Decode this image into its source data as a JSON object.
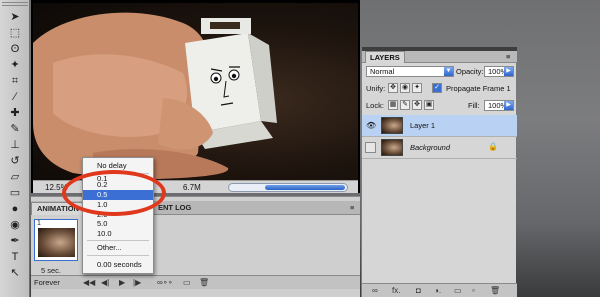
{
  "toolbox": {
    "tools": [
      {
        "icon": "move-tool-icon",
        "glyph": "➤"
      },
      {
        "icon": "marquee-tool-icon",
        "glyph": "⬚"
      },
      {
        "icon": "lasso-tool-icon",
        "glyph": "ʘ"
      },
      {
        "icon": "magic-wand-tool-icon",
        "glyph": "✦"
      },
      {
        "icon": "crop-tool-icon",
        "glyph": "⌗"
      },
      {
        "icon": "eyedropper-tool-icon",
        "glyph": "⁄"
      },
      {
        "icon": "healing-brush-tool-icon",
        "glyph": "✚"
      },
      {
        "icon": "brush-tool-icon",
        "glyph": "✎"
      },
      {
        "icon": "clone-stamp-tool-icon",
        "glyph": "⊥"
      },
      {
        "icon": "history-brush-tool-icon",
        "glyph": "↺"
      },
      {
        "icon": "eraser-tool-icon",
        "glyph": "▱"
      },
      {
        "icon": "gradient-tool-icon",
        "glyph": "▭"
      },
      {
        "icon": "blur-tool-icon",
        "glyph": "●"
      },
      {
        "icon": "dodge-tool-icon",
        "glyph": "◉"
      },
      {
        "icon": "pen-tool-icon",
        "glyph": "✒"
      },
      {
        "icon": "type-tool-icon",
        "glyph": "T"
      },
      {
        "icon": "path-selection-tool-icon",
        "glyph": "↖"
      }
    ]
  },
  "image_window": {
    "zoom": "12.5%",
    "doc_info": "6.7M"
  },
  "animation_panel": {
    "tab_animation": "ANIMATION",
    "tab_measurement": "ENT LOG",
    "frame_number": "1",
    "frame_delay": "5 sec.",
    "loop": "Forever",
    "controls": [
      "◀◀",
      "◀|",
      "▶",
      "|▶",
      "∞∘∘",
      "▭",
      "🗑"
    ]
  },
  "delay_menu": {
    "items": [
      {
        "label": "No delay",
        "selected": false
      },
      {
        "label": "0.1",
        "selected": false
      },
      {
        "label": "0.2",
        "selected": false
      },
      {
        "label": "0.5",
        "selected": true
      },
      {
        "label": "1.0",
        "selected": false
      },
      {
        "label": "2.0",
        "selected": false
      },
      {
        "label": "5.0",
        "selected": false
      },
      {
        "label": "10.0",
        "selected": false
      },
      {
        "label": "Other...",
        "selected": false
      },
      {
        "label": "0.00 seconds",
        "selected": false
      }
    ]
  },
  "layers_panel": {
    "tab_title": "LAYERS",
    "blend_mode": "Normal",
    "opacity_label": "Opacity:",
    "opacity_value": "100%",
    "unify_label": "Unify:",
    "propagate_label": "Propagate Frame 1",
    "lock_label": "Lock:",
    "fill_label": "Fill:",
    "fill_value": "100%",
    "layers": [
      {
        "name": "Layer 1",
        "active": true,
        "visible": true,
        "locked": false
      },
      {
        "name": "Background",
        "active": false,
        "visible": false,
        "locked": true
      }
    ],
    "footer_icons": [
      "∞",
      "fx.",
      "◘",
      "◑.",
      "▭",
      "▫",
      "🗑"
    ]
  },
  "colors": {
    "accent": "#3c6fd4",
    "highlight_ring": "#e0381c"
  }
}
